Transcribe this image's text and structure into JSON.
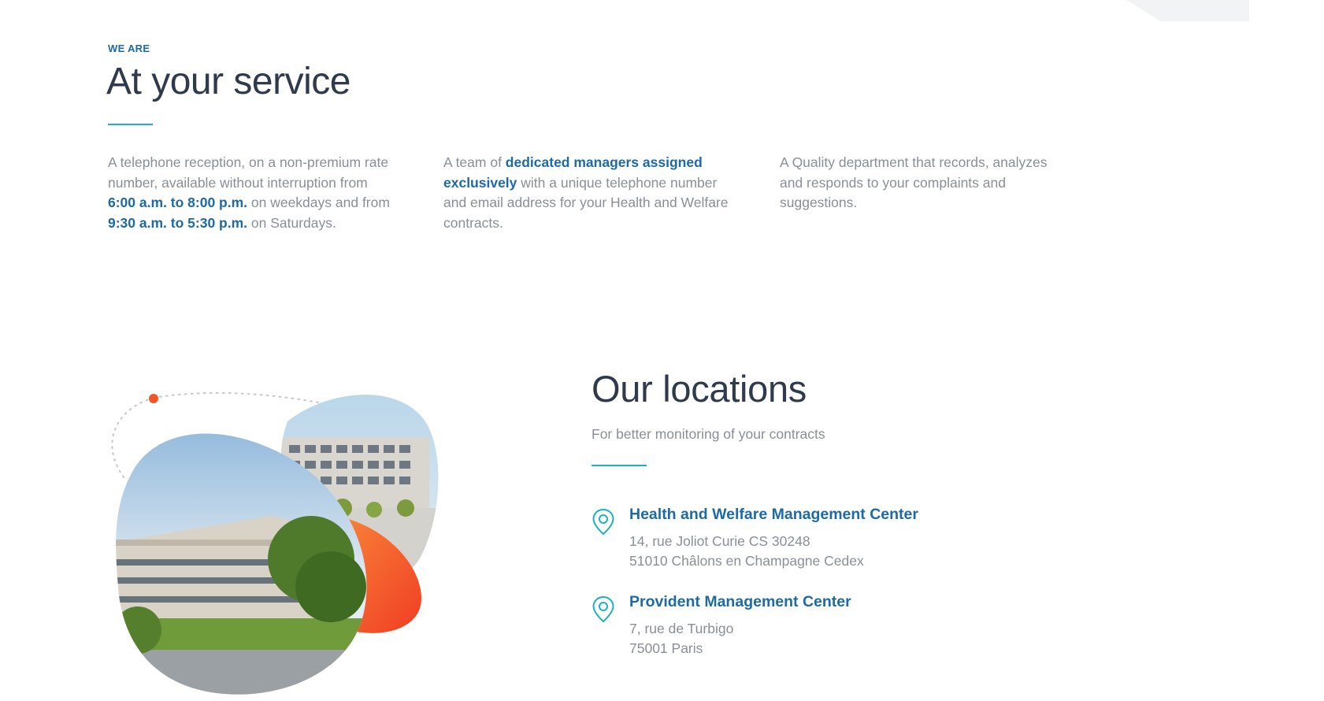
{
  "service": {
    "eyebrow": "WE ARE",
    "title": "At your service",
    "columns": [
      {
        "t1": "A telephone reception, on a non-premium rate number, available without interruption from ",
        "b1": "6:00 a.m. to 8:00 p.m.",
        "t2": " on weekdays and from ",
        "b2": "9:30 a.m. to 5:30 p.m.",
        "t3": " on Saturdays."
      },
      {
        "t1": "A team of ",
        "b1": "dedicated managers assigned exclusively",
        "t2": " with a unique telephone number and email address for your Health and Welfare contracts."
      },
      {
        "t1": "A Quality department that records, analyzes and responds to your complaints and suggestions."
      }
    ]
  },
  "locations": {
    "title": "Our locations",
    "subtitle": "For better monitoring of your contracts",
    "items": [
      {
        "name": "Health and Welfare Management Center",
        "line1": "14, rue Joliot Curie CS 30248",
        "line2": "51010 Châlons en Champagne Cedex",
        "icon": "location-pin-icon"
      },
      {
        "name": "Provident Management Center",
        "line1": "7, rue de Turbigo",
        "line2": "75001 Paris",
        "icon": "location-pin-icon"
      }
    ]
  },
  "colors": {
    "brand_blue": "#1d6aa5",
    "accent_teal": "#1cb1c3",
    "accent_orange": "#f4562a",
    "heading": "#2f3b4c",
    "body_text": "#8a8f97"
  }
}
